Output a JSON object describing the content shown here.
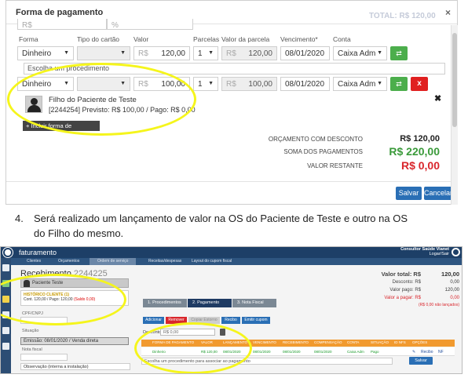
{
  "modal": {
    "title": "Forma de pagamento",
    "ghost_header": "TOTAL: R$ 120,00",
    "top_input_prefix": "R$",
    "top_input_pct": "%",
    "col_headers": [
      "Forma",
      "Tipo do cartão",
      "Valor",
      "Parcelas",
      "Valor da parcela",
      "Vencimento*",
      "Conta"
    ],
    "row1": {
      "forma": "Dinheiro",
      "currency": "R$",
      "valor": "120,00",
      "parcelas": "1",
      "parcela_currency": "R$",
      "valor_parcela": "120,00",
      "vencimento": "08/01/2020",
      "conta": "Caixa Adm"
    },
    "procedure_hint": "Escolha um procedimento",
    "row2": {
      "forma": "Dinheiro",
      "currency": "R$",
      "valor": "100,00",
      "parcelas": "1",
      "parcela_currency": "R$",
      "valor_parcela": "100,00",
      "vencimento": "08/01/2020",
      "conta": "Caixa Adm"
    },
    "remove_label": "x",
    "person": {
      "name": "Filho do Paciente de Teste",
      "info": "[2244254] Previsto: R$ 100,00 / Pago: R$ 0,00"
    },
    "person_close": "✖",
    "add_payment": "+ Incluir forma de pagamento",
    "summary": [
      {
        "label": "ORÇAMENTO COM DESCONTO",
        "value": "R$ 120,00",
        "color": "#222222"
      },
      {
        "label": "SOMA DOS PAGAMENTOS",
        "value": "R$ 220,00",
        "color": "#3a9a3a"
      },
      {
        "label": "VALOR RESTANTE",
        "value": "R$ 0,00",
        "color": "#d9262c"
      }
    ],
    "save": "Salvar",
    "cancel": "Cancelar"
  },
  "instruction": {
    "number": "4.",
    "line1": "Será realizado um lançamento de valor na OS do Paciente de Teste e outro na OS",
    "line2": "do Filho do mesmo."
  },
  "app": {
    "title": "faturamento",
    "user_line1": "Consultor Saúde Vianet",
    "user_line2": "Logar/Sair",
    "nav": [
      "Clientes",
      "Orçamentos",
      "Ordem de serviço",
      "Receitas/despesas",
      "Layout do cupom fiscal"
    ],
    "receipt_label": "Recebimento",
    "receipt_id": "2244225",
    "patient": "Paciente Teste",
    "history_title": "HISTÓRICO CLIENTE (1)",
    "history_line_prefix": "Cont. 120,00 / Pago: 120,00 ",
    "history_line_red": "(Saldo 0,00)",
    "cpf_label": "CPF/CNPJ",
    "situacao_label": "Situação",
    "emission": "Emissão: 08/01/2020 / Venda direta",
    "nota_label": "Nota fiscal",
    "obs_label": "Observação (interna a instalação)",
    "steps": [
      "1. Procedimentos",
      "2. Pagamento",
      "3. Nota Fiscal"
    ],
    "toolbar": [
      "Adicionar",
      "Remover",
      "Copiar Estorno",
      "Recibo",
      "Emitir cupom"
    ],
    "desc_label": "Desconto",
    "desc_value": "R$ 0,00",
    "table_headers": [
      "FORMA DE PAGAMENTO",
      "VALOR",
      "LANÇAMENTO",
      "VENCIMENTO",
      "RECEBIMENTO",
      "COMPENSAÇÃO",
      "CONTA",
      "SITUAÇÃO",
      "ID NFS",
      "OPÇÕES"
    ],
    "table_row": [
      "Dinheiro",
      "R$ 120,00",
      "08/01/2020",
      "08/01/2020",
      "08/01/2020",
      "08/01/2020",
      "Caixa Adm",
      "Pago"
    ],
    "row_options": [
      "Recibo",
      "NF"
    ],
    "procedure_hint": "Escolha um procedimento para associar ao pagamento",
    "save": "Salvar",
    "totals": [
      {
        "label": "Valor total: R$",
        "value": "120,00",
        "bold": true,
        "color": "#222222"
      },
      {
        "label": "Desconto: R$",
        "value": "0,00",
        "bold": false,
        "color": "#444444"
      },
      {
        "label": "Valor pago: R$",
        "value": "120,00",
        "bold": false,
        "color": "#444444"
      },
      {
        "label": "Valor a pagar: R$",
        "value": "0,00",
        "bold": false,
        "color": "#d9262c"
      }
    ],
    "totals_note": "(R$ 0,00 não lançados)"
  }
}
